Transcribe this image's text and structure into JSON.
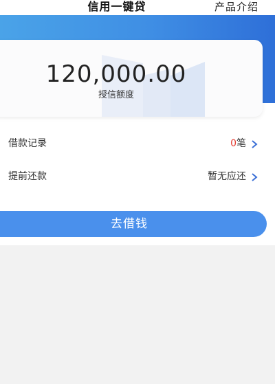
{
  "nav": {
    "title": "信用一键贷",
    "right_link": "产品介绍"
  },
  "credit": {
    "amount": "120,000.00",
    "label": "授信额度"
  },
  "rows": [
    {
      "label": "借款记录",
      "count": "0",
      "unit": "笔"
    },
    {
      "label": "提前还款",
      "value": "暂无应还"
    }
  ],
  "action": {
    "button_label": "去借钱"
  },
  "colors": {
    "accent": "#4a90ec",
    "banner": "#3f8ee4",
    "count_red": "#e33a2f"
  }
}
